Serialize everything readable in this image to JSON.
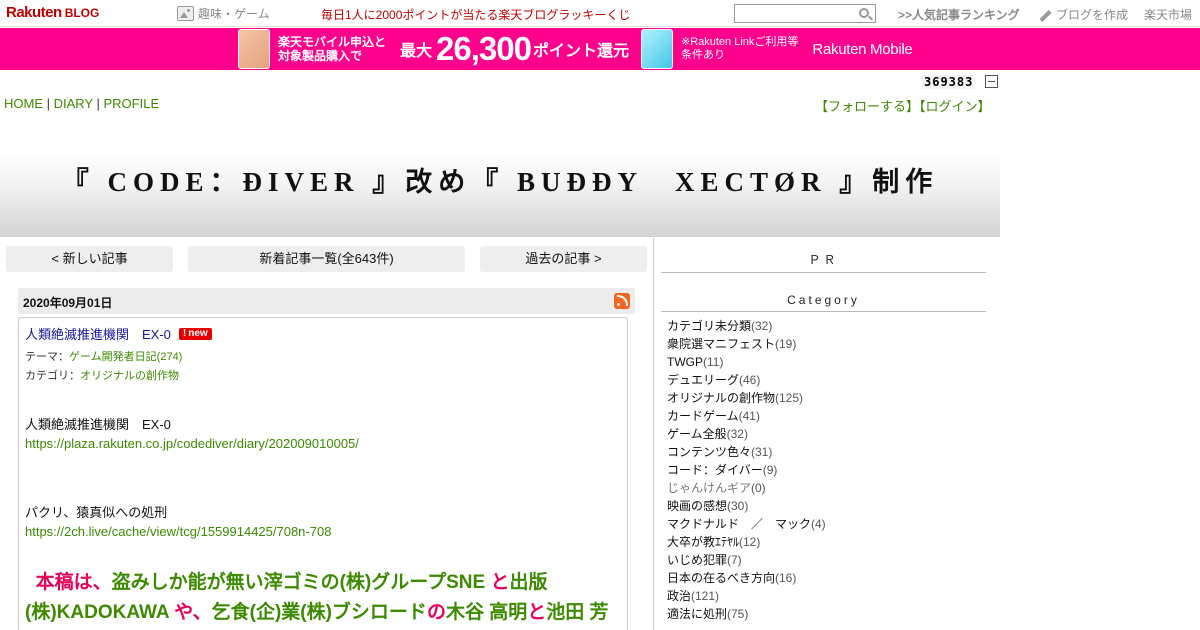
{
  "header": {
    "logo_rakuten": "Rakuten",
    "logo_blog": "BLOG",
    "hobby": "趣味・ゲーム",
    "lucky": "毎日1人に2000ポイントが当たる楽天ブログラッキーくじ",
    "search_value": "",
    "ranking": ">>人気記事ランキング",
    "create_blog": "ブログを作成",
    "market": "楽天市場"
  },
  "banner": {
    "line1": "楽天モバイル申込と",
    "line2": "対象製品購入で",
    "max": "最大",
    "points": "26,300",
    "points_suffix": "ポイント還元",
    "note1": "※Rakuten Linkご利用等",
    "note2": "条件あり",
    "brand": "Rakuten Mobile",
    "bg_color": "#ff008c"
  },
  "counter": "369383",
  "nav": {
    "home": "HOME",
    "diary": "DIARY",
    "profile": "PROFILE",
    "sep": " | ",
    "follow": "【フォローする】",
    "login": "【ログイン】"
  },
  "blog_title": "『 CODE：ĐIVER 』改め『 BUĐĐY　XECTØR 』制作",
  "pager": {
    "newer": "< 新しい記事",
    "list": "新着記事一覧(全643件)",
    "older": "過去の記事 >"
  },
  "article": {
    "date": "2020年09月01日",
    "title": "人類絶滅推進機関　EX-0",
    "new_badge": "new",
    "theme_label": "テーマ：",
    "theme": "ゲーム開発者日記(274)",
    "category_label": "カテゴリ：",
    "category": "オリジナルの創作物",
    "para1": "人類絶滅推進機関　EX-0",
    "link1": "https://plaza.rakuten.co.jp/codediver/diary/202009010005/",
    "para2": "パクリ、猿真似への処刑",
    "link2": "https://2ch.live/cache/view/tcg/1559914425/708n-708",
    "big": {
      "s1": "本稿は、",
      "s2": "盗みしか能が無い滓ゴミの(株)グループSNE",
      "s3": " と",
      "s4": "出版(株)KADOKAWA",
      "s5": " や、",
      "s6": "乞食(企)業(株)ブシロード",
      "s7": "の",
      "s8": "木谷 高明",
      "s9": "と",
      "s10": "池田 芳"
    }
  },
  "sidebar": {
    "pr": "ＰＲ",
    "category_head": "Category",
    "categories": [
      {
        "name": "カテゴリ未分類",
        "count": "(32)"
      },
      {
        "name": "衆院選マニフェスト",
        "count": "(19)"
      },
      {
        "name": "TWGP",
        "count": "(11)"
      },
      {
        "name": "デュエリーグ",
        "count": "(46)"
      },
      {
        "name": "オリジナルの創作物",
        "count": "(125)"
      },
      {
        "name": "カードゲーム",
        "count": "(41)"
      },
      {
        "name": "ゲーム全般",
        "count": "(32)"
      },
      {
        "name": "コンテンツ色々",
        "count": "(31)"
      },
      {
        "name": "コード：ダイバー",
        "count": "(9)"
      },
      {
        "name": "じゃんけんギア",
        "count": "(0)"
      },
      {
        "name": "映画の感想",
        "count": "(30)"
      },
      {
        "name": "マクドナルド　／　マック",
        "count": "(4)"
      },
      {
        "name": "大卒が教ｴﾃﾔﾙ",
        "count": "(12)"
      },
      {
        "name": "いじめ犯罪",
        "count": "(7)"
      },
      {
        "name": "日本の在るべき方向",
        "count": "(16)"
      },
      {
        "name": "政治",
        "count": "(121)"
      },
      {
        "name": "適法に処刑",
        "count": "(75)"
      }
    ]
  }
}
